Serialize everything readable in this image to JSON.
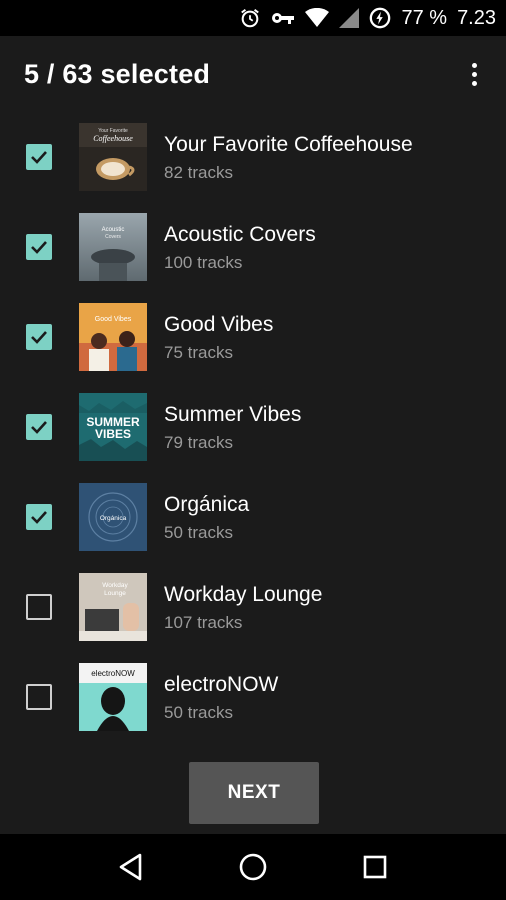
{
  "status_bar": {
    "battery_text": "77 %",
    "time": "7.23",
    "icons": [
      "alarm-icon",
      "key-icon",
      "wifi-icon",
      "signal-icon",
      "battery-charging-icon"
    ]
  },
  "header": {
    "title": "5 / 63 selected",
    "menu_icon": "more-vert-icon"
  },
  "accent_color": "#7dd1c4",
  "playlists": [
    {
      "title": "Your Favorite Coffeehouse",
      "subtitle": "82 tracks",
      "checked": true,
      "thumb_text": "Your Favorite Coffeehouse"
    },
    {
      "title": "Acoustic Covers",
      "subtitle": "100 tracks",
      "checked": true,
      "thumb_text": "Acoustic Covers"
    },
    {
      "title": "Good Vibes",
      "subtitle": "75 tracks",
      "checked": true,
      "thumb_text": "Good Vibes"
    },
    {
      "title": "Summer Vibes",
      "subtitle": "79 tracks",
      "checked": true,
      "thumb_text": "SUMMER VIBES"
    },
    {
      "title": "Orgánica",
      "subtitle": "50 tracks",
      "checked": true,
      "thumb_text": "Orgánica"
    },
    {
      "title": "Workday Lounge",
      "subtitle": "107 tracks",
      "checked": false,
      "thumb_text": "Workday Lounge"
    },
    {
      "title": "electroNOW",
      "subtitle": "50 tracks",
      "checked": false,
      "thumb_text": "electroNOW"
    }
  ],
  "next_button": {
    "label": "NEXT"
  },
  "nav_bar": {
    "icons": [
      "back-icon",
      "home-icon",
      "recents-icon"
    ]
  }
}
